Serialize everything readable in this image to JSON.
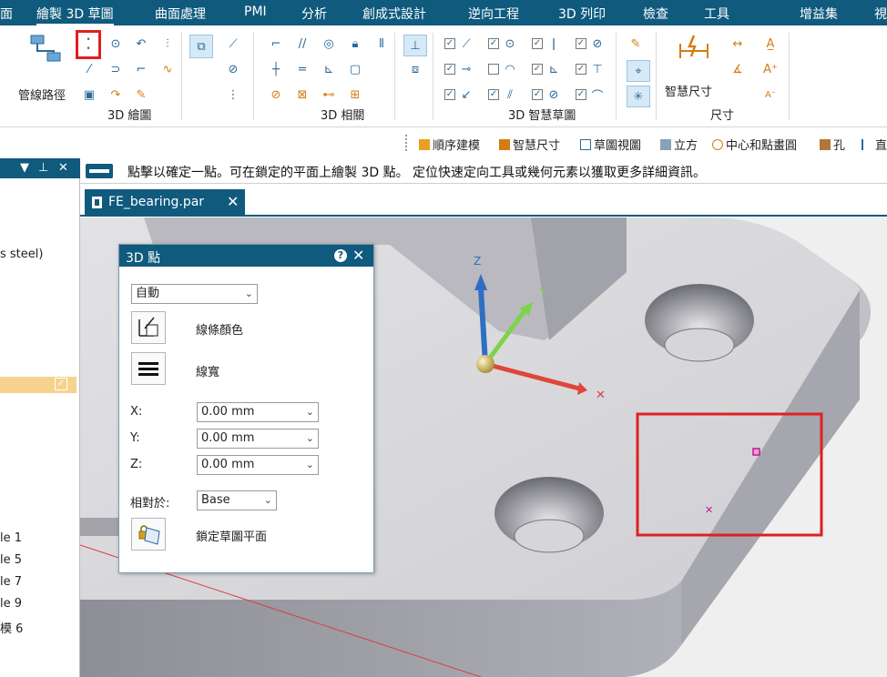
{
  "menu": {
    "items": [
      "面",
      "繪製 3D 草圖",
      "曲面處理",
      "PMI",
      "分析",
      "創成式設計",
      "逆向工程",
      "3D 列印",
      "檢查",
      "工具",
      "增益集",
      "視"
    ],
    "active": "繪製 3D 草圖"
  },
  "ribbon": {
    "groups": {
      "draw3d": "3D 繪圖",
      "relate3d": "3D 相關",
      "smart3d": "3D 智慧草圖",
      "dimension": "尺寸"
    },
    "pipe_path_label": "管線路徑",
    "smart_dimension_label": "智慧尺寸"
  },
  "qat": {
    "items": [
      "順序建模",
      "智慧尺寸",
      "草圖視圖",
      "立方",
      "中心和點畫圓",
      "孔",
      "直"
    ]
  },
  "sidebar": {
    "fragments": [
      "s steel)",
      "le 1",
      "le 5",
      "le 7",
      "le 9",
      "模 6"
    ]
  },
  "prompt": {
    "text": "點擊以確定一點。可在鎖定的平面上繪製 3D 點。 定位快速定向工具或幾何元素以獲取更多詳細資訊。"
  },
  "document_tab": {
    "name": "FE_bearing.par"
  },
  "triad": {
    "z_label": "Z",
    "y_label": "Y"
  },
  "dialog": {
    "title": "3D 點",
    "mode": "自動",
    "line_color_label": "線條顏色",
    "line_width_label": "線寬",
    "x_label": "X:",
    "y_label": "Y:",
    "z_label": "Z:",
    "x_value": "0.00 mm",
    "y_value": "0.00 mm",
    "z_value": "0.00 mm",
    "relative_label": "相對於:",
    "relative_value": "Base",
    "lock_label": "鎖定草圖平面"
  },
  "colors": {
    "accent": "#0f5a7d",
    "highlight_red": "#e02020",
    "part_surface": "#d7d7da"
  }
}
